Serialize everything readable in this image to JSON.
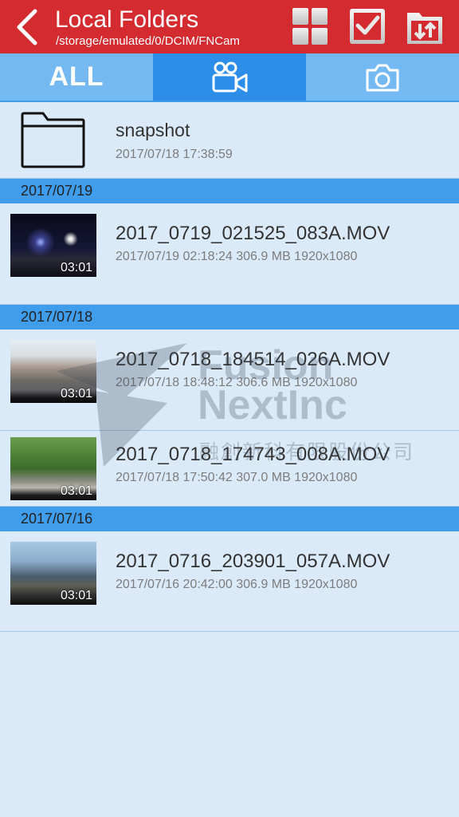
{
  "header": {
    "title": "Local Folders",
    "path": "/storage/emulated/0/DCIM/FNCam",
    "icons": [
      "back-arrow-icon",
      "grid-view-icon",
      "select-checkbox-icon",
      "folder-sort-icon"
    ]
  },
  "tabs": [
    {
      "label": "ALL",
      "icon": "none"
    },
    {
      "label": "",
      "icon": "video-camera-icon"
    },
    {
      "label": "",
      "icon": "photo-camera-icon"
    }
  ],
  "folder": {
    "name": "snapshot",
    "date": "2017/07/18 17:38:59"
  },
  "groups": [
    {
      "date": "2017/07/19",
      "items": [
        {
          "name": "2017_0719_021525_083A.MOV",
          "meta": "2017/07/19 02:18:24  306.9 MB  1920x1080",
          "duration": "03:01"
        }
      ]
    },
    {
      "date": "2017/07/18",
      "items": [
        {
          "name": "2017_0718_184514_026A.MOV",
          "meta": "2017/07/18 18:48:12  306.6 MB  1920x1080",
          "duration": "03:01"
        },
        {
          "name": "2017_0718_174743_008A.MOV",
          "meta": "2017/07/18 17:50:42  307.0 MB  1920x1080",
          "duration": "03:01"
        }
      ]
    },
    {
      "date": "2017/07/16",
      "items": [
        {
          "name": "2017_0716_203901_057A.MOV",
          "meta": "2017/07/16 20:42:00  306.9 MB  1920x1080",
          "duration": "03:01"
        }
      ]
    }
  ],
  "watermark": {
    "line1": "Fusion",
    "line2": "NextInc",
    "line3": "融創新科有限股份公司"
  },
  "colors": {
    "header": "#d32b2f",
    "tab": "#74b9f2",
    "tab_active": "#2c8ee8",
    "date_header": "#3f9deb",
    "background": "#dbeaf9"
  }
}
